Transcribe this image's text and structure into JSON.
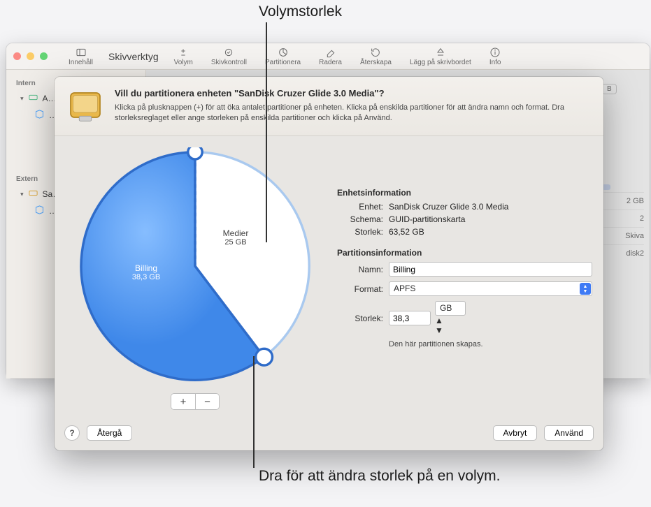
{
  "annotations": {
    "top": "Volymstorlek",
    "bottom": "Dra för att ändra storlek på en volym."
  },
  "window": {
    "app_title": "Skivverktyg",
    "toolbar": {
      "view_label": "Innehåll",
      "volume": "Volym",
      "first_aid": "Skivkontroll",
      "partition": "Partitionera",
      "erase": "Radera",
      "restore": "Återskapa",
      "mount": "Lägg på skrivbordet",
      "info": "Info"
    }
  },
  "sidebar": {
    "section_internal": "Intern",
    "section_external": "Extern",
    "internal_items": [
      {
        "label": "A…"
      },
      {
        "label": "…"
      }
    ],
    "external_items": [
      {
        "label": "Sa…"
      },
      {
        "label": "…"
      }
    ]
  },
  "right_strip": {
    "badge": "B",
    "rows": [
      "2 GB",
      "2",
      "Skiva",
      "disk2"
    ]
  },
  "sheet": {
    "title": "Vill du partitionera enheten \"SanDisk Cruzer Glide 3.0 Media\"?",
    "desc": "Klicka på plusknappen (+) för att öka antalet partitioner på enheten. Klicka på enskilda partitioner för att ändra namn och format. Dra storleksreglaget eller ange storleken på enskilda partitioner och klicka på Använd.",
    "pie": {
      "billing_name": "Billing",
      "billing_size": "38,3 GB",
      "medier_name": "Medier",
      "medier_size": "25 GB"
    },
    "plus": "+",
    "minus": "−",
    "device_info_title": "Enhetsinformation",
    "device_label": "Enhet:",
    "device_value": "SanDisk Cruzer Glide 3.0 Media",
    "scheme_label": "Schema:",
    "scheme_value": "GUID-partitionskarta",
    "total_label": "Storlek:",
    "total_value": "63,52 GB",
    "partition_info_title": "Partitionsinformation",
    "name_label": "Namn:",
    "name_value": "Billing",
    "format_label": "Format:",
    "format_value": "APFS",
    "size_label": "Storlek:",
    "size_value": "38,3",
    "size_unit": "GB",
    "note": "Den här partitionen skapas.",
    "help": "?",
    "revert": "Återgå",
    "cancel": "Avbryt",
    "apply": "Använd"
  },
  "chart_data": {
    "type": "pie",
    "title": "",
    "series": [
      {
        "name": "Billing",
        "value": 38.3,
        "unit": "GB",
        "color": "#4e98f3"
      },
      {
        "name": "Medier",
        "value": 25,
        "unit": "GB",
        "color": "#ffffff"
      }
    ],
    "total": 63.52
  }
}
